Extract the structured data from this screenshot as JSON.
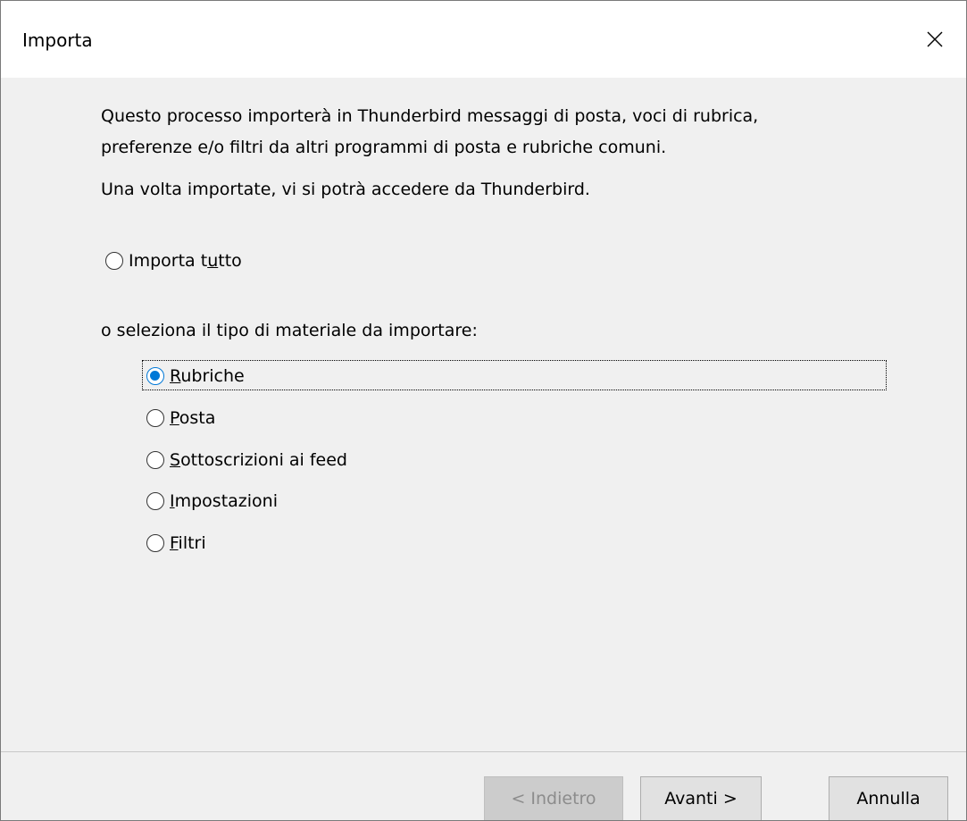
{
  "window": {
    "title": "Importa",
    "close_icon": "close-icon"
  },
  "intro": {
    "line1": "Questo processo importerà in Thunderbird messaggi di posta, voci di rubrica,",
    "line2": "preferenze e/o filtri da altri programmi di posta e rubriche comuni.",
    "line3": "Una volta importate, vi si potrà accedere da Thunderbird."
  },
  "import_all": {
    "label_pre": "Importa t",
    "label_accel": "u",
    "label_post": "tto",
    "checked": false
  },
  "select_prompt": "o seleziona il tipo di materiale da importare:",
  "options": [
    {
      "accel": "R",
      "rest": "ubriche",
      "checked": true
    },
    {
      "accel": "P",
      "rest": "osta",
      "checked": false
    },
    {
      "accel": "S",
      "rest": "ottoscrizioni ai feed",
      "checked": false
    },
    {
      "accel": "I",
      "rest": "mpostazioni",
      "checked": false
    },
    {
      "accel": "F",
      "rest": "iltri",
      "checked": false
    }
  ],
  "buttons": {
    "back": "< Indietro",
    "next": "Avanti >",
    "cancel": "Annulla"
  },
  "colors": {
    "accent": "#0078d7",
    "dialog_bg": "#f0f0f0",
    "titlebar_bg": "#ffffff"
  }
}
